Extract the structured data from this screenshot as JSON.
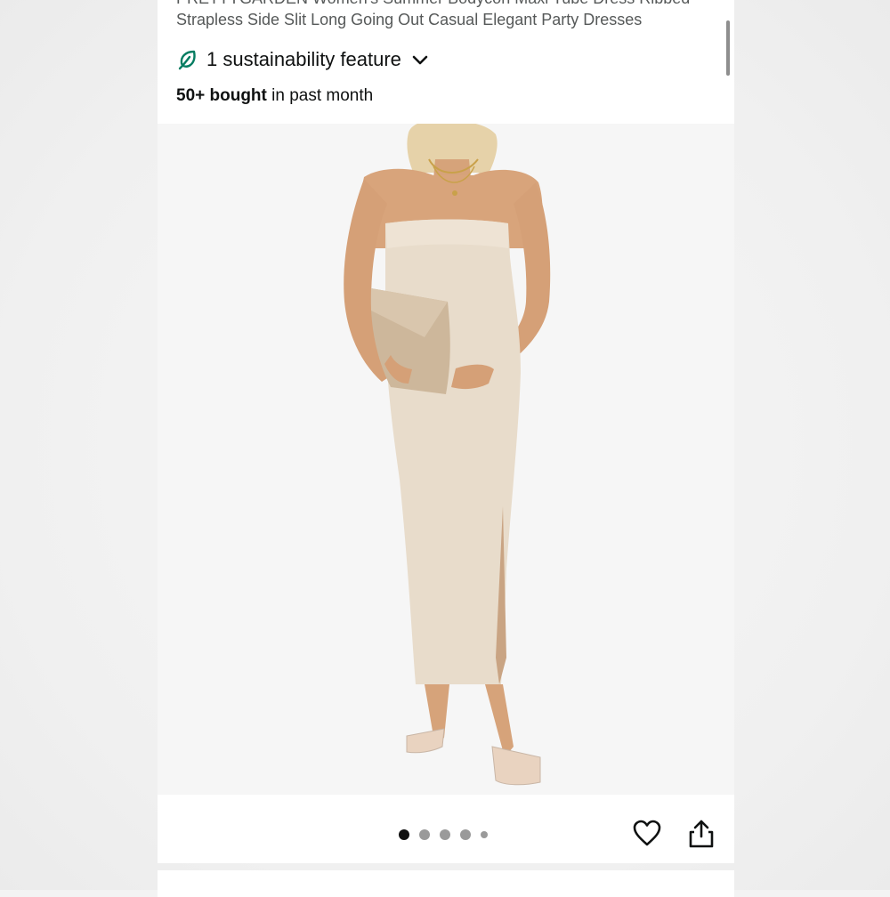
{
  "product": {
    "title_line1": "PRETTYGARDEN Women's Summer Bodycon Maxi Tube Dress Ribbed",
    "title_line2": "Strapless Side Slit Long Going Out Casual Elegant Party Dresses"
  },
  "sustainability": {
    "label": "1 sustainability feature",
    "icon": "leaf-icon",
    "color": "#067d62"
  },
  "purchases": {
    "count": "50+ bought",
    "suffix": "in past month"
  },
  "image": {
    "description_colors": {
      "dress": "#e8dccb",
      "clutch": "#cdb79b",
      "skin": "#d9a77e"
    }
  },
  "carousel": {
    "total_dots": 5,
    "active_index": 0
  },
  "actions": {
    "favorite_icon": "heart-icon",
    "share_icon": "share-icon"
  }
}
